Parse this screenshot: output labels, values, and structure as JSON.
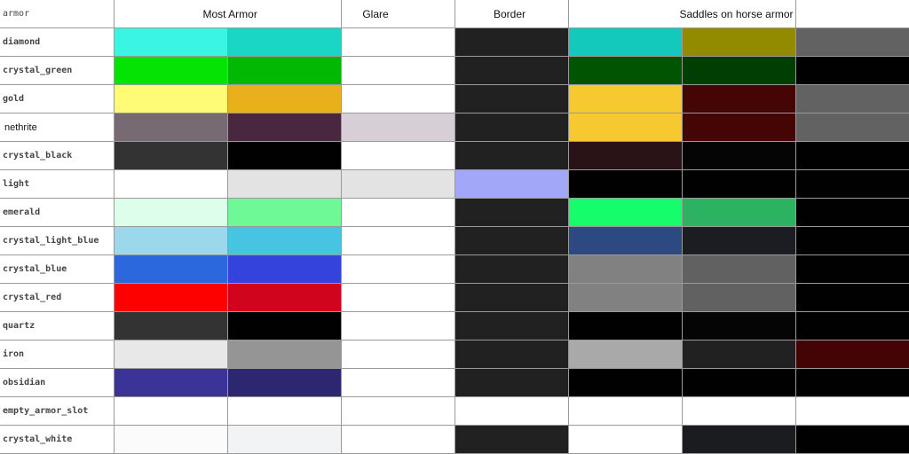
{
  "header": {
    "armor_label": "armor",
    "most_armor_label": "Most Armor",
    "glare_label": "Glare",
    "border_label": "Border",
    "saddles_label": "Saddles on horse armor"
  },
  "rows": [
    {
      "name": "diamond",
      "plain": false,
      "colors": [
        "#3bf5e3",
        "#1ad6c5",
        "#ffffff",
        "#212121",
        "#13c9bc",
        "#928b00",
        "#626262"
      ]
    },
    {
      "name": "crystal_green",
      "plain": false,
      "colors": [
        "#05e305",
        "#03b803",
        "#ffffff",
        "#212121",
        "#015401",
        "#013e01",
        "#010101"
      ]
    },
    {
      "name": "gold",
      "plain": false,
      "colors": [
        "#fffb76",
        "#e9af1c",
        "#ffffff",
        "#212121",
        "#f5c92f",
        "#450505",
        "#626262"
      ]
    },
    {
      "name": "nethrite",
      "plain": true,
      "colors": [
        "#776a73",
        "#4a2740",
        "#d8cfd6",
        "#212121",
        "#f5c92f",
        "#450505",
        "#626262"
      ]
    },
    {
      "name": "crystal_black",
      "plain": false,
      "colors": [
        "#333333",
        "#010101",
        "#ffffff",
        "#212121",
        "#2a1316",
        "#050505",
        "#010101"
      ]
    },
    {
      "name": "light",
      "plain": false,
      "colors": [
        "#ffffff",
        "#e3e3e3",
        "#e3e3e3",
        "#a2a7f8",
        "#010101",
        "#010101",
        "#010101"
      ]
    },
    {
      "name": "emerald",
      "plain": false,
      "colors": [
        "#dcfeea",
        "#6ef896",
        "#ffffff",
        "#212121",
        "#16fd6b",
        "#2bb362",
        "#010101"
      ]
    },
    {
      "name": "crystal_light_blue",
      "plain": false,
      "colors": [
        "#9bd8ec",
        "#48c4e3",
        "#ffffff",
        "#212121",
        "#2c4a81",
        "#1b1d22",
        "#010101"
      ]
    },
    {
      "name": "crystal_blue",
      "plain": false,
      "colors": [
        "#2a68dc",
        "#3443dc",
        "#ffffff",
        "#212121",
        "#818181",
        "#616161",
        "#010101"
      ]
    },
    {
      "name": "crystal_red",
      "plain": false,
      "colors": [
        "#fd0000",
        "#d1041d",
        "#ffffff",
        "#212121",
        "#818181",
        "#616161",
        "#010101"
      ]
    },
    {
      "name": "quartz",
      "plain": false,
      "colors": [
        "#333333",
        "#010101",
        "#ffffff",
        "#212121",
        "#010101",
        "#050505",
        "#010101"
      ]
    },
    {
      "name": "iron",
      "plain": false,
      "colors": [
        "#e8e8e8",
        "#959595",
        "#ffffff",
        "#212121",
        "#a9a9a9",
        "#212121",
        "#440405"
      ]
    },
    {
      "name": "obsidian",
      "plain": false,
      "colors": [
        "#3b3397",
        "#2d2772",
        "#ffffff",
        "#212121",
        "#010101",
        "#010101",
        "#010101"
      ]
    },
    {
      "name": "empty_armor_slot",
      "plain": false,
      "colors": [
        "#ffffff",
        "#ffffff",
        "#ffffff",
        "#ffffff",
        "#ffffff",
        "#ffffff",
        "#ffffff"
      ]
    },
    {
      "name": "crystal_white",
      "plain": false,
      "colors": [
        "#fbfbfb",
        "#f2f3f4",
        "#ffffff",
        "#212121",
        "#ffffff",
        "#1b1c20",
        "#010101"
      ]
    }
  ]
}
